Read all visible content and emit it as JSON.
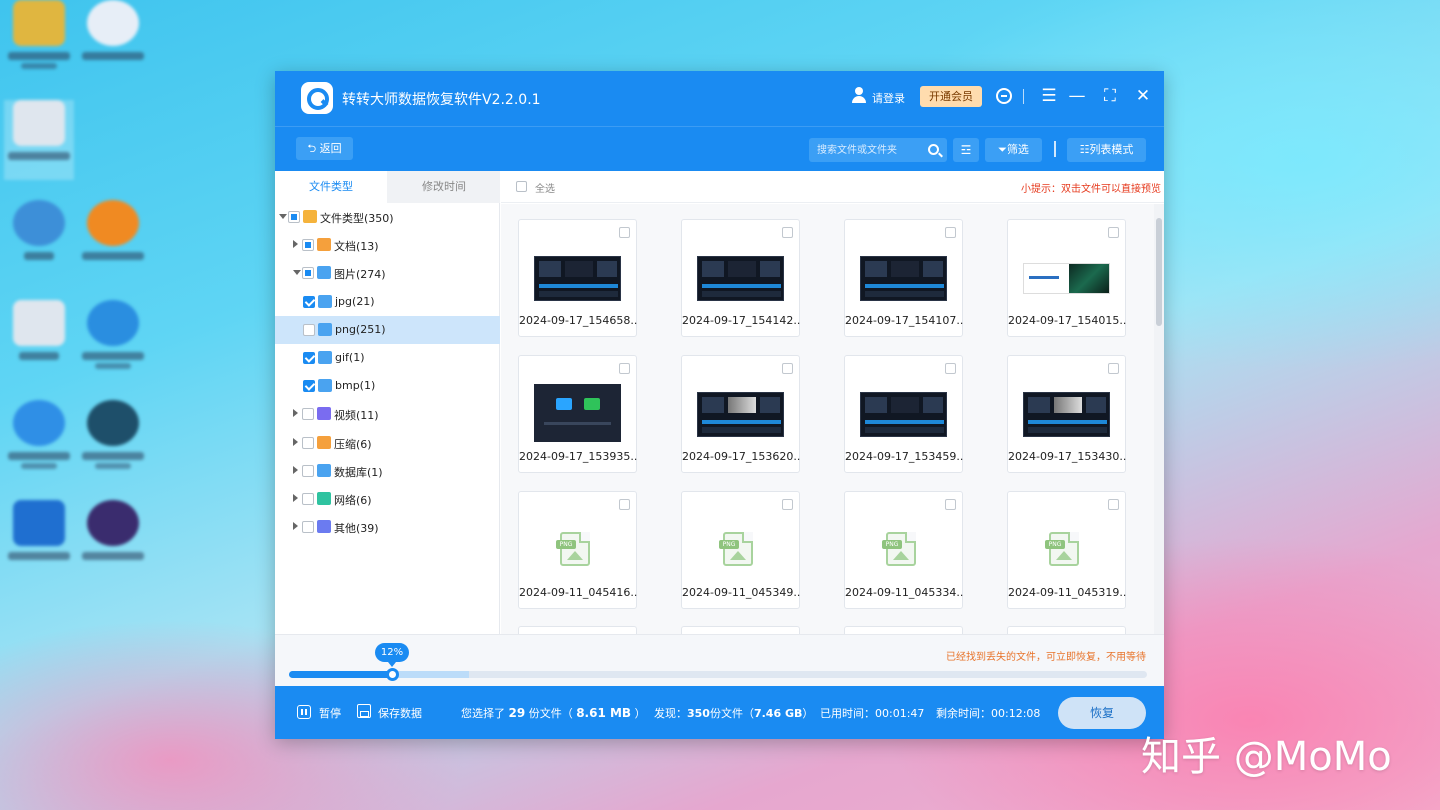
{
  "watermark": "知乎 @MoMo",
  "app": {
    "title": "转转大师数据恢复软件V2.2.0.1",
    "login": "请登录",
    "vip": "开通会员",
    "back": "返回",
    "search_placeholder": "搜索文件或文件夹",
    "filter": "筛选",
    "list_mode": "列表模式"
  },
  "sidebar": {
    "tabs": [
      "文件类型",
      "修改时间"
    ],
    "tree": [
      {
        "label": "文件类型(350)",
        "level": 0,
        "expanded": true,
        "check": "partial",
        "icon": "folder-icon",
        "color": "#f5b33c"
      },
      {
        "label": "文档(13)",
        "level": 1,
        "expanded": false,
        "check": "partial",
        "icon": "document-icon",
        "color": "#f5a03c"
      },
      {
        "label": "图片(274)",
        "level": 1,
        "expanded": true,
        "check": "partial",
        "icon": "image-icon",
        "color": "#4aa3f0"
      },
      {
        "label": "jpg(21)",
        "level": 2,
        "check": "full",
        "icon": "image-file-icon",
        "color": "#4aa3f0"
      },
      {
        "label": "png(251)",
        "level": 2,
        "check": "none",
        "icon": "image-file-icon",
        "color": "#4aa3f0",
        "selected": true
      },
      {
        "label": "gif(1)",
        "level": 2,
        "check": "full",
        "icon": "image-file-icon",
        "color": "#4aa3f0"
      },
      {
        "label": "bmp(1)",
        "level": 2,
        "check": "full",
        "icon": "image-file-icon",
        "color": "#4aa3f0"
      },
      {
        "label": "视频(11)",
        "level": 1,
        "expanded": false,
        "check": "none",
        "icon": "video-icon",
        "color": "#7a6cf0"
      },
      {
        "label": "压缩(6)",
        "level": 1,
        "expanded": false,
        "check": "none",
        "icon": "archive-icon",
        "color": "#f5a03c"
      },
      {
        "label": "数据库(1)",
        "level": 1,
        "expanded": false,
        "check": "none",
        "icon": "database-icon",
        "color": "#4aa3f0"
      },
      {
        "label": "网络(6)",
        "level": 1,
        "expanded": false,
        "check": "none",
        "icon": "network-icon",
        "color": "#2fc3a0"
      },
      {
        "label": "其他(39)",
        "level": 1,
        "expanded": false,
        "check": "none",
        "icon": "other-icon",
        "color": "#6b7bf0"
      }
    ]
  },
  "content": {
    "select_all": "全选",
    "hint": "小提示：双击文件可以直接预览",
    "files": [
      {
        "name": "2024-09-17_154658...",
        "thumb": "dark"
      },
      {
        "name": "2024-09-17_154142...",
        "thumb": "dark"
      },
      {
        "name": "2024-09-17_154107...",
        "thumb": "dark"
      },
      {
        "name": "2024-09-17_154015...",
        "thumb": "banner"
      },
      {
        "name": "2024-09-17_153935...",
        "thumb": "app"
      },
      {
        "name": "2024-09-17_153620...",
        "thumb": "bright"
      },
      {
        "name": "2024-09-17_153459...",
        "thumb": "dark"
      },
      {
        "name": "2024-09-17_153430...",
        "thumb": "bright"
      },
      {
        "name": "2024-09-11_045416...",
        "thumb": "png"
      },
      {
        "name": "2024-09-11_045349...",
        "thumb": "png"
      },
      {
        "name": "2024-09-11_045334...",
        "thumb": "png"
      },
      {
        "name": "2024-09-11_045319...",
        "thumb": "png"
      }
    ]
  },
  "progress": {
    "percent_label": "12%",
    "percent": 12,
    "found_text": "已经找到丢失的文件，可立即恢复，不用等待"
  },
  "bottom": {
    "pause": "暂停",
    "save": "保存数据",
    "selected_prefix": "您选择了",
    "selected_count": "29",
    "selected_mid": "份文件（",
    "selected_size": "8.61 MB",
    "selected_suffix": "）",
    "found_prefix": "发现：",
    "found_count": "350",
    "found_mid": "份文件（",
    "found_size": "7.46 GB",
    "found_suffix": "）",
    "elapsed": "已用时间：00:01:47",
    "remaining": "剩余时间：00:12:08",
    "recover": "恢复"
  },
  "desktop_icons": [
    {
      "name": "user-folder-icon",
      "color": "#e0b640"
    },
    {
      "name": "network-app-icon",
      "color": "#e7eef7"
    },
    {
      "name": "computer-icon",
      "color": "#dfe6ee"
    },
    {
      "name": "network-globe-icon",
      "color": "#3d8fd8"
    },
    {
      "name": "video-app-icon",
      "color": "#f08a22"
    },
    {
      "name": "recycle-bin-icon",
      "color": "#dfe6ee"
    },
    {
      "name": "browser-icon",
      "color": "#2a8ee0"
    },
    {
      "name": "ie-icon",
      "color": "#2f8fe6"
    },
    {
      "name": "disc-app-icon",
      "color": "#1e4f6a"
    },
    {
      "name": "settings-app-icon",
      "color": "#1f6fd0"
    },
    {
      "name": "game-app-icon",
      "color": "#3a2c6e"
    }
  ]
}
